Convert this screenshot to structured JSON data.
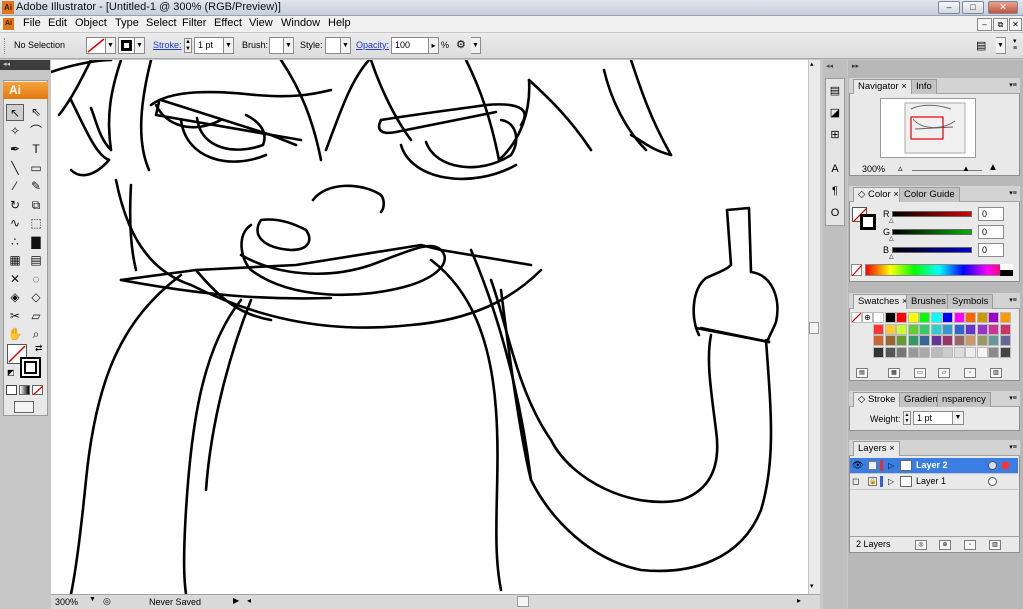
{
  "window": {
    "title": "Adobe Illustrator - [Untitled-1 @ 300% (RGB/Preview)]",
    "logo_text": "Ai",
    "minimize": "–",
    "maximize": "□",
    "close": "✕"
  },
  "menu": [
    "File",
    "Edit",
    "Object",
    "Type",
    "Select",
    "Filter",
    "Effect",
    "View",
    "Window",
    "Help"
  ],
  "mdi": {
    "minimize": "–",
    "restore": "⧉",
    "close": "✕"
  },
  "control_bar": {
    "selection": "No Selection",
    "stroke_label": "Stroke:",
    "stroke_value": "1 pt",
    "brush_label": "Brush:",
    "style_label": "Style:",
    "opacity_label": "Opacity:",
    "opacity_value": "100",
    "percent": "%"
  },
  "tools": {
    "logo": "Ai",
    "items": [
      {
        "name": "selection-tool",
        "glyph": "↖"
      },
      {
        "name": "direct-selection-tool",
        "glyph": "⇖"
      },
      {
        "name": "magic-wand-tool",
        "glyph": "✧"
      },
      {
        "name": "lasso-tool",
        "glyph": "⌒"
      },
      {
        "name": "pen-tool",
        "glyph": "✒"
      },
      {
        "name": "type-tool",
        "glyph": "T"
      },
      {
        "name": "line-tool",
        "glyph": "╲"
      },
      {
        "name": "rectangle-tool",
        "glyph": "▭"
      },
      {
        "name": "paintbrush-tool",
        "glyph": "⁄"
      },
      {
        "name": "pencil-tool",
        "glyph": "✎"
      },
      {
        "name": "rotate-tool",
        "glyph": "↻"
      },
      {
        "name": "scale-tool",
        "glyph": "⧉"
      },
      {
        "name": "warp-tool",
        "glyph": "∿"
      },
      {
        "name": "free-transform-tool",
        "glyph": "⬚"
      },
      {
        "name": "symbol-sprayer-tool",
        "glyph": "∴"
      },
      {
        "name": "column-graph-tool",
        "glyph": "▇"
      },
      {
        "name": "mesh-tool",
        "glyph": "▦"
      },
      {
        "name": "gradient-tool",
        "glyph": "▤"
      },
      {
        "name": "eyedropper-tool",
        "glyph": "✕"
      },
      {
        "name": "blend-tool",
        "glyph": "◌"
      },
      {
        "name": "live-paint-tool",
        "glyph": "◈"
      },
      {
        "name": "live-paint-selection-tool",
        "glyph": "◇"
      },
      {
        "name": "slice-tool",
        "glyph": "✂"
      },
      {
        "name": "eraser-tool",
        "glyph": "▱"
      },
      {
        "name": "hand-tool",
        "glyph": "✋"
      },
      {
        "name": "zoom-tool",
        "glyph": "⌕"
      }
    ]
  },
  "status": {
    "zoom": "300%",
    "state": "Never Saved"
  },
  "navigator": {
    "tabs": [
      "Navigator",
      "Info"
    ],
    "zoom": "300%"
  },
  "color": {
    "tabs": [
      "Color",
      "Color Guide"
    ],
    "channels": [
      {
        "label": "R",
        "value": "0",
        "color": "#d40000"
      },
      {
        "label": "G",
        "value": "0",
        "color": "#00b000"
      },
      {
        "label": "B",
        "value": "0",
        "color": "#0000d0"
      }
    ]
  },
  "swatches": {
    "tabs": [
      "Swatches",
      "Brushes",
      "Symbols"
    ],
    "colors": [
      "#ffffff",
      "#000000",
      "#ff0000",
      "#ffff00",
      "#00ff00",
      "#00ffff",
      "#0000ff",
      "#ff00ff",
      "#ff6600",
      "#cc9900",
      "#9900cc",
      "#ff9900",
      "#ff3333",
      "#ffcc33",
      "#ccff33",
      "#66cc33",
      "#33cc66",
      "#33cccc",
      "#3399cc",
      "#3366cc",
      "#6633cc",
      "#9933cc",
      "#cc3399",
      "#cc3366",
      "#cc6633",
      "#996633",
      "#669933",
      "#339966",
      "#336699",
      "#663399",
      "#993366",
      "#996666",
      "#cc9966",
      "#999966",
      "#669999",
      "#666699",
      "#333333",
      "#555555",
      "#777777",
      "#999999",
      "#aaaaaa",
      "#bbbbbb",
      "#cccccc",
      "#dddddd",
      "#eeeeee",
      "#f4f4f4",
      "#8a8a8a",
      "#444444"
    ]
  },
  "stroke": {
    "tabs": [
      "Stroke",
      "Gradient",
      "nsparency"
    ],
    "weight_label": "Weight:",
    "weight_value": "1 pt"
  },
  "layers": {
    "tabs": [
      "Layers"
    ],
    "items": [
      {
        "name": "Layer 2",
        "color": "#e03030",
        "selected": true
      },
      {
        "name": "Layer 1",
        "color": "#3060e0",
        "selected": false
      }
    ],
    "count": "2 Layers"
  }
}
